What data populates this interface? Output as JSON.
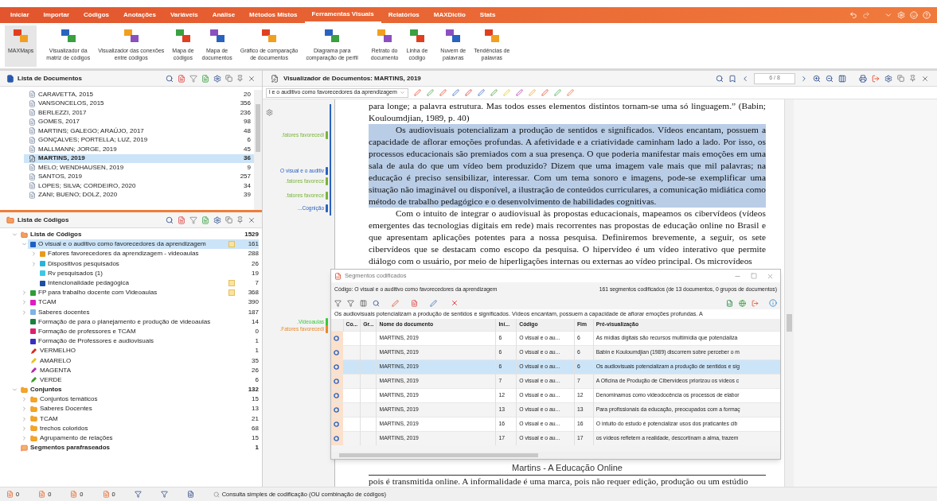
{
  "menu_tabs": [
    {
      "label": "Iniciar",
      "selected": false
    },
    {
      "label": "Importar",
      "selected": false
    },
    {
      "label": "Códigos",
      "selected": false
    },
    {
      "label": "Anotações",
      "selected": false
    },
    {
      "label": "Variáveis",
      "selected": false
    },
    {
      "label": "Análise",
      "selected": false
    },
    {
      "label": "Métodos Mistos",
      "selected": false
    },
    {
      "label": "Ferramentas Visuais",
      "selected": true
    },
    {
      "label": "Relatórios",
      "selected": false
    },
    {
      "label": "MAXDictio",
      "selected": false
    },
    {
      "label": "Stats",
      "selected": false
    }
  ],
  "ribbon_buttons": [
    {
      "label": "MAXMaps",
      "selected": true
    },
    {
      "label": "Visualizador da\nmatriz de códigos",
      "selected": false
    },
    {
      "label": "Visualizador das conexões\nentre códigos",
      "selected": false
    },
    {
      "label": "Mapa de\ncódigos",
      "selected": false
    },
    {
      "label": "Mapa de\ndocumentos",
      "selected": false
    },
    {
      "label": "Gráfico de comparação\nde documentos",
      "selected": false
    },
    {
      "label": "Diagrama para\ncomparação de perfil",
      "selected": false
    },
    {
      "label": "Retrato do\ndocumento",
      "selected": false
    },
    {
      "label": "Linha de\ncódigo",
      "selected": false
    },
    {
      "label": "Nuvem de\npalavras",
      "selected": false
    },
    {
      "label": "Tendências de\npalavras",
      "selected": false
    }
  ],
  "document_list": {
    "title": "Lista de Documentos",
    "items": [
      {
        "name": "CARAVETTA, 2015",
        "count": "20",
        "selected": false
      },
      {
        "name": "VANSONCELOS, 2015",
        "count": "356",
        "selected": false
      },
      {
        "name": "BERLEZZI, 2017",
        "count": "236",
        "selected": false
      },
      {
        "name": "GOMES, 2017",
        "count": "98",
        "selected": false
      },
      {
        "name": "MARTINS; GALEGO; ARAÚJO, 2017",
        "count": "48",
        "selected": false
      },
      {
        "name": "GONÇALVES; PORTELLA; LUZ, 2019",
        "count": "6",
        "selected": false
      },
      {
        "name": "MALLMANN; JORGE, 2019",
        "count": "45",
        "selected": false
      },
      {
        "name": "MARTINS, 2019",
        "count": "36",
        "selected": true
      },
      {
        "name": "MELO; WENDHAUSEN, 2019",
        "count": "9",
        "selected": false
      },
      {
        "name": "SANTOS, 2019",
        "count": "257",
        "selected": false
      },
      {
        "name": "LOPES; SILVA; CORDEIRO, 2020",
        "count": "34",
        "selected": false
      },
      {
        "name": "ZANI; BUENO; DOLZ, 2020",
        "count": "39",
        "selected": false
      }
    ]
  },
  "code_list": {
    "title": "Lista de Códigos",
    "items": [
      {
        "kind": "root",
        "name": "Lista de Códigos",
        "count": "1529",
        "expanded": true,
        "selected": false,
        "children": [
          {
            "kind": "code",
            "name": "O visual e o auditivo como favorecedores da aprendizagem",
            "count": "161",
            "expanded": true,
            "selected": true,
            "memo": true,
            "color": "#1f5fc4",
            "children": [
              {
                "kind": "code",
                "name": "Fatores favorecedores da aprendizagem - videoaulas",
                "count": "288",
                "expanded": false,
                "selected": false,
                "color": "#e89a1c"
              },
              {
                "kind": "code",
                "name": "Dispositivos pesquisados",
                "count": "26",
                "expanded": false,
                "selected": false,
                "color": "#28b4d8"
              },
              {
                "kind": "code",
                "name": "Rv pesquisados (1)",
                "count": "19",
                "selected": false,
                "color": "#3cc8e6"
              },
              {
                "kind": "code",
                "name": "Intencionalidade pedagógica",
                "count": "7",
                "selected": false,
                "memo": true,
                "color": "#1c4fa0"
              }
            ]
          },
          {
            "kind": "code",
            "name": "FP para trabalho docente com Videoaulas",
            "count": "368",
            "expanded": false,
            "selected": false,
            "memo": true,
            "color": "#2e9e34"
          },
          {
            "kind": "code",
            "name": "TCAM",
            "count": "390",
            "expanded": false,
            "selected": false,
            "color": "#e01cc0"
          },
          {
            "kind": "code",
            "name": "Saberes docentes",
            "count": "187",
            "expanded": false,
            "selected": false,
            "color": "#7fb2e6"
          },
          {
            "kind": "code",
            "name": "Formação de para o planejamento e produção de videoaulas",
            "count": "14",
            "selected": false,
            "color": "#1e7e3e"
          },
          {
            "kind": "code",
            "name": "Formação de professores e TCAM",
            "count": "0",
            "selected": false,
            "color": "#e0206e"
          },
          {
            "kind": "code",
            "name": "Formação de Professores e audiovisuais",
            "count": "1",
            "selected": false,
            "color": "#3a2ec0"
          },
          {
            "kind": "pen",
            "name": "VERMELHO",
            "count": "1",
            "selected": false,
            "color": "#d42a1a"
          },
          {
            "kind": "pen",
            "name": "AMARELO",
            "count": "35",
            "selected": false,
            "color": "#e8c21a"
          },
          {
            "kind": "pen",
            "name": "MAGENTA",
            "count": "26",
            "selected": false,
            "color": "#b02aa8"
          },
          {
            "kind": "pen",
            "name": "VERDE",
            "count": "6",
            "selected": false,
            "color": "#3a9a2a"
          }
        ]
      },
      {
        "kind": "sets_root",
        "name": "Conjuntos",
        "count": "132",
        "expanded": true,
        "selected": false,
        "children": [
          {
            "kind": "set",
            "name": "Conjuntos temáticos",
            "count": "15",
            "expanded": false,
            "selected": false
          },
          {
            "kind": "set",
            "name": "Saberes Docentes",
            "count": "13",
            "expanded": false,
            "selected": false
          },
          {
            "kind": "set",
            "name": "TCAM",
            "count": "21",
            "expanded": false,
            "selected": false
          },
          {
            "kind": "set",
            "name": "trechos coloridos",
            "count": "68",
            "expanded": false,
            "selected": false
          },
          {
            "kind": "set",
            "name": "Agrupamento de relações",
            "count": "15",
            "expanded": false,
            "selected": false
          }
        ]
      },
      {
        "kind": "paraphrase",
        "name": "Segmentos parafraseados",
        "count": "1",
        "selected": false
      }
    ]
  },
  "document_viewer": {
    "title": "Visualizador de Documentos: MARTINS, 2019",
    "page": "6 / 8",
    "code_selector": "l e o auditivo como favorecedores da aprendizagem",
    "margin_codes": [
      {
        "label": ".fatores favorecedi",
        "color": "#7ab33a"
      },
      {
        "label": "O visual e o auditiv",
        "color": "#2a62c0"
      },
      {
        "label": ".fatores favorece",
        "color": "#7ab33a"
      },
      {
        "label": ".fatores favorece",
        "color": "#7ab33a"
      },
      {
        "label": "...Cognição",
        "color": "#2a62c0"
      },
      {
        "label": ".Videoaulas",
        "color": "#3cc83c"
      },
      {
        "label": ".Fatores favorecedi",
        "color": "#e8892a"
      }
    ],
    "paragraphs": [
      {
        "kind": "continuation",
        "text": "para longe; a palavra estrutura. Mas todos esses elementos distintos tornam-se uma só linguagem.” (Babin; Kouloumdjian, 1989, p. 40)",
        "highlighted": false
      },
      {
        "kind": "paragraph",
        "text": "Os audiovisuais potencializam a produção de sentidos e significados. Vídeos encantam, possuem a capacidade de aflorar emoções profundas. A afetividade e a criatividade caminham lado a lado. Por isso, os processos educacionais são premiados com a sua presença. O que poderia manifestar mais emoções em uma sala de aula do que um vídeo bem produzido? Dizem que uma imagem vale mais que mil palavras; na educação é preciso sensibilizar, interessar. Com um tema sonoro e imagens, pode-se exemplificar uma situação não imaginável ou disponível, a ilustração de conteúdos curriculares, a comunicação midiática como método de trabalho pedagógico e o desenvolvimento de habilidades cognitivas.",
        "highlighted": true
      },
      {
        "kind": "paragraph",
        "text": "Com o intuito de integrar o audiovisual às propostas educacionais, mapeamos os cibervídeos (vídeos emergentes das tecnologias digitais em rede) mais recorrentes nas propostas de educação online no Brasil e que apresentam aplicações potentes para a nossa pesquisa. Definiremos brevemente, a seguir, os sete cibervídeos que se destacam como escopo da pesquisa. O hipervídeo é um vídeo interativo que permite diálogo com o usuário, por meio de hiperligações internas ou externas ao vídeo principal. Os microvídeos",
        "highlighted": false
      }
    ],
    "footer": "Martins - A Educação Online",
    "next_page_text": "pois é transmitida online. A informalidade é uma marca, pois não requer edição, produção ou um estúdio"
  },
  "coded_segments": {
    "title": "Segmentos codificados",
    "code_label": "Código: O visual e o auditivo como favorecedores da aprendizagem",
    "summary": "161 segmentos codificados (de 13 documentos, 0 grupos de documentos)",
    "preview": "Os audiovisuais potencializam a produção de sentidos e significados. Vídeos encantam, possuem a  capacidade de aflorar emoções profundas. A",
    "columns": [
      "Co...",
      "Gr...",
      "Nome do documento",
      "Iní...",
      "Código",
      "Fim",
      "Pré-visualização"
    ],
    "rows": [
      {
        "document": "MARTINS, 2019",
        "start": "6",
        "code": "O visual e o au...",
        "end": "6",
        "preview": "As mídias digitais são recursos multimídia que potencializa",
        "selected": false
      },
      {
        "document": "MARTINS, 2019",
        "start": "6",
        "code": "O visual e o au...",
        "end": "6",
        "preview": "Babin e Kouloumdjian (1989) discorrem sobre perceber o m",
        "selected": false
      },
      {
        "document": "MARTINS, 2019",
        "start": "6",
        "code": "O visual e o au...",
        "end": "6",
        "preview": "Os audiovisuais potencializam a produção de sentidos e sig",
        "selected": true
      },
      {
        "document": "MARTINS, 2019",
        "start": "7",
        "code": "O visual e o au...",
        "end": "7",
        "preview": "A Oficina de Produção de Cibervídeos priorizou os vídeos c",
        "selected": false
      },
      {
        "document": "MARTINS, 2019",
        "start": "12",
        "code": "O visual e o au...",
        "end": "12",
        "preview": "Denominamos como videodocência os processos de elabor",
        "selected": false
      },
      {
        "document": "MARTINS, 2019",
        "start": "13",
        "code": "O visual e o au...",
        "end": "13",
        "preview": "Para profissionais da educação, preocupados com a formaç",
        "selected": false
      },
      {
        "document": "MARTINS, 2019",
        "start": "16",
        "code": "O visual e o au...",
        "end": "16",
        "preview": "O intuito do estudo é potencializar usos dos praticantes cib",
        "selected": false
      },
      {
        "document": "MARTINS, 2019",
        "start": "17",
        "code": "O visual e o au...",
        "end": "17",
        "preview": "os vídeos refletem a realidade, descortinam a alma, trazem",
        "selected": false
      }
    ]
  },
  "status_bar": {
    "counters": [
      "0",
      "0",
      "0",
      "0"
    ],
    "query_text": "Consulta simples de codificação (OU combinação de códigos)"
  }
}
